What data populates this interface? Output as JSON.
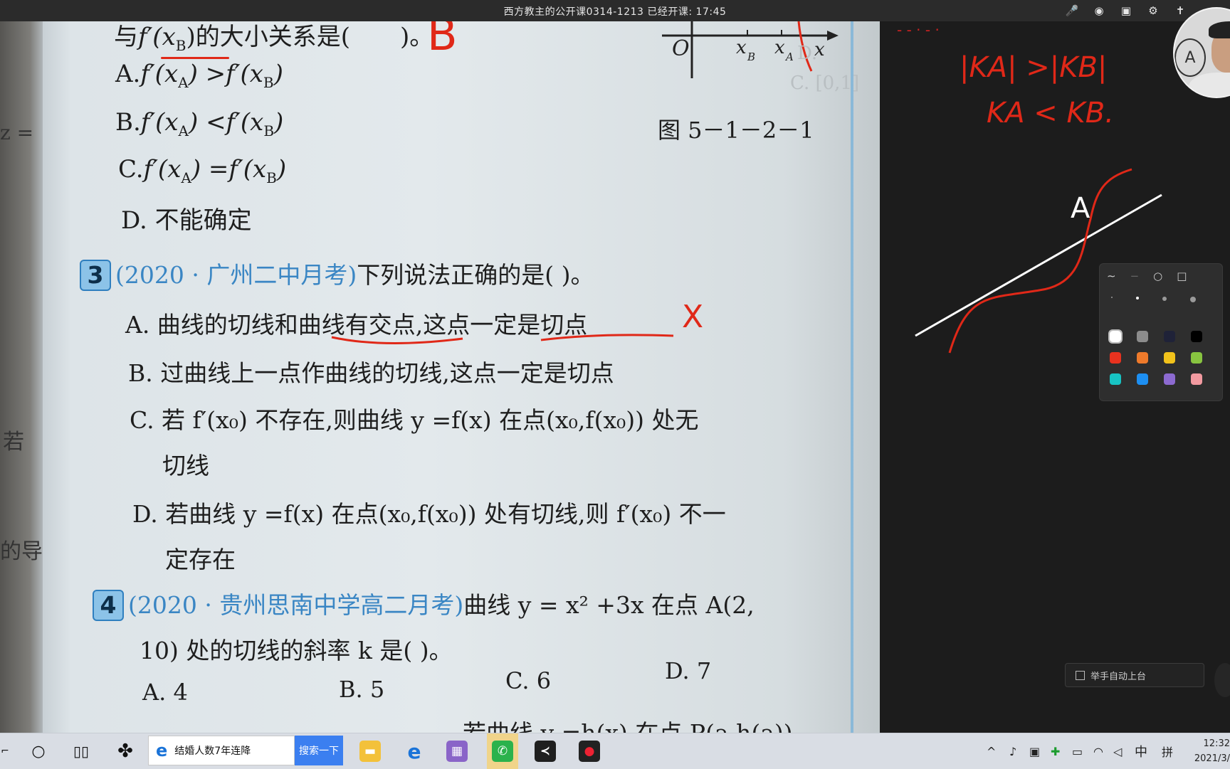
{
  "window": {
    "title": "西方教主的公开课0314-1213   已经开课: 17:45"
  },
  "book": {
    "line1_prefix": "与",
    "line1_expr": "f′(x",
    "line1_sub": "B",
    "line1_suffix": ")的大小关系是(",
    "line1_close": ")。",
    "answer_q2": "B",
    "q2_options": [
      {
        "letter": "A.",
        "text": "f′(x",
        "s1": "A",
        "mid": ") >f′(x",
        "s2": "B",
        "end": ")"
      },
      {
        "letter": "B.",
        "text": "f′(x",
        "s1": "A",
        "mid": ") <f′(x",
        "s2": "B",
        "end": ")"
      },
      {
        "letter": "C.",
        "text": "f′(x",
        "s1": "A",
        "mid": ") =f′(x",
        "s2": "B",
        "end": ")"
      },
      {
        "letter": "D.",
        "text": "不能确定",
        "s1": "",
        "mid": "",
        "s2": "",
        "end": ""
      }
    ],
    "figure_axis": {
      "origin": "O",
      "xb": "x",
      "xb_sub": "B",
      "xa": "x",
      "xa_sub": "A",
      "x": "x"
    },
    "figure_caption": "图 5－1－2－1",
    "q3": {
      "num": "3",
      "source": "(2020 · 广州二中月考)",
      "stem": "下列说法正确的是(        )。",
      "options": [
        "A. 曲线的切线和曲线有交点,这点一定是切点",
        "B. 过曲线上一点作曲线的切线,这点一定是切点",
        "C. 若 f′(x₀) 不存在,则曲线 y =f(x) 在点(x₀,f(x₀)) 处无",
        "切线",
        "D. 若曲线 y =f(x) 在点(x₀,f(x₀)) 处有切线,则 f′(x₀) 不一",
        "定存在"
      ],
      "mark_a": "X"
    },
    "q4": {
      "num": "4",
      "source": "(2020 · 贵州思南中学高二月考)",
      "stem": "曲线 y = x² +3x 在点 A(2,",
      "stem2": "10) 处的切线的斜率 k 是(         )。",
      "options": [
        "A. 4",
        "B. 5",
        "C. 6",
        "D. 7"
      ]
    },
    "bottom_line": "若曲线 y =h(x) 在点 P(a,h(a))",
    "side_text": [
      "z =",
      "若",
      "的导"
    ],
    "right_faded": [
      "C. [0,1]",
      "D."
    ]
  },
  "board": {
    "note_line1": "|KA| >|KB|",
    "note_line2": "KA < KB.",
    "point_label": "A"
  },
  "palette": {
    "tools": [
      "∼",
      "−",
      "○",
      "□"
    ],
    "colors": [
      "#ffffff",
      "#8c8c8c",
      "#1f2238",
      "#000000",
      "#e8321f",
      "#ee7a2b",
      "#f1c21b",
      "#88c440",
      "#17c3c3",
      "#1d8ff2",
      "#8c6ad0",
      "#f29aa0"
    ]
  },
  "raise_hand": {
    "label": "举手自动上台"
  },
  "taskbar": {
    "search_text": "结婚人数7年连降",
    "search_button": "搜索一下",
    "ime_lang": "中",
    "ime_mode": "拼",
    "time": "12:32",
    "date": "2021/3/"
  }
}
